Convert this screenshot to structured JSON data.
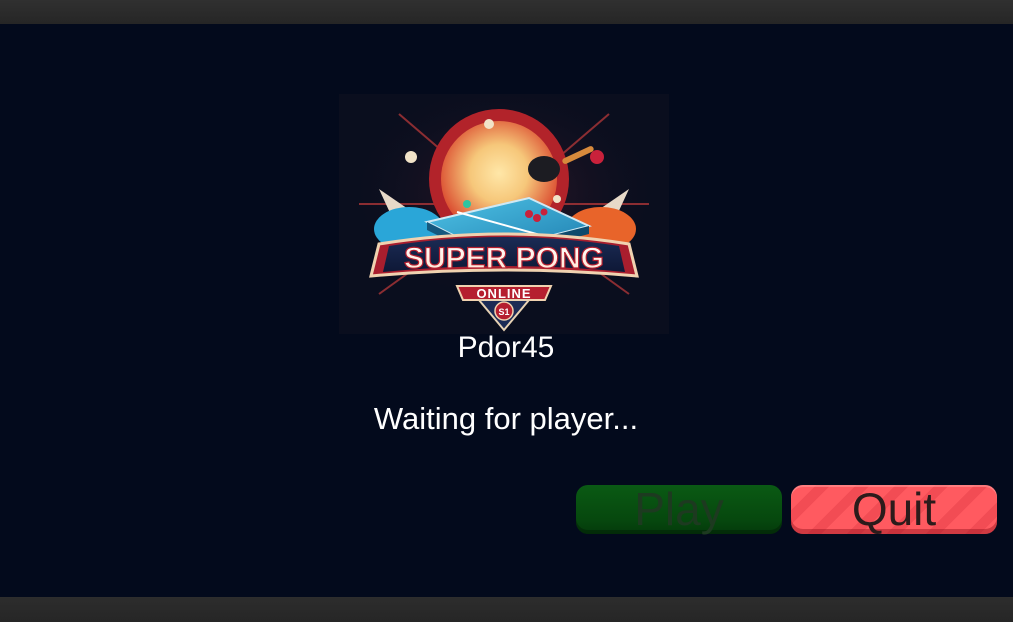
{
  "logo": {
    "title": "SUPER PONG",
    "subtitle": "ONLINE",
    "badge": "S1"
  },
  "player": {
    "name": "Pdor45"
  },
  "status": {
    "text": "Waiting for player..."
  },
  "buttons": {
    "play_label": "Play",
    "quit_label": "Quit"
  },
  "colors": {
    "background": "#030a1c",
    "play_button": "#06480e",
    "quit_button": "#ff5a60",
    "letterbox": "#2a2a2a"
  }
}
